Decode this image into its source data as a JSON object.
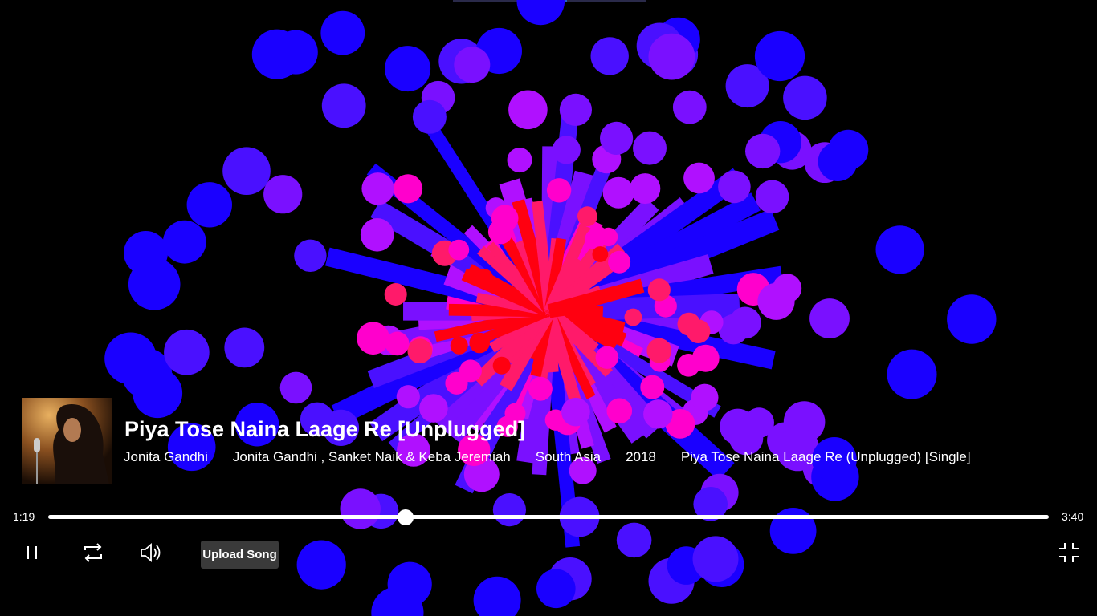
{
  "player": {
    "title": "Piya Tose Naina Laage Re [Unplugged]",
    "meta": [
      "Jonita Gandhi",
      "Jonita Gandhi , Sanket Naik & Keba Jeremiah",
      "South Asia",
      "2018",
      "Piya Tose Naina Laage Re (Unplugged) [Single]"
    ],
    "current_time": "1:19",
    "total_time": "3:40",
    "progress": 0.357
  },
  "controls": {
    "pause_icon": "pause-icon",
    "repeat_icon": "repeat-icon",
    "volume_icon": "volume-icon",
    "upload_label": "Upload Song",
    "fullscreen_exit_icon": "exit-fullscreen-icon"
  },
  "visualizer": {
    "colors": [
      "#1a00ff",
      "#4a10ff",
      "#7a10ff",
      "#b010ff",
      "#ff00cc",
      "#ff1a6a",
      "#ff0010"
    ]
  }
}
